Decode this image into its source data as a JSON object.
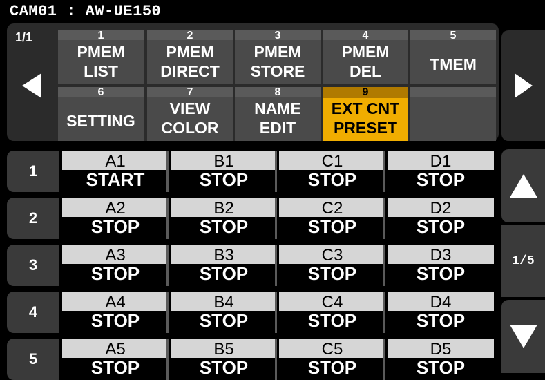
{
  "header": {
    "title": "CAM01 : AW-UE150"
  },
  "menu": {
    "page": "1/1",
    "buttons": [
      {
        "num": "1",
        "lines": [
          "PMEM",
          "LIST"
        ]
      },
      {
        "num": "2",
        "lines": [
          "PMEM",
          "DIRECT"
        ]
      },
      {
        "num": "3",
        "lines": [
          "PMEM",
          "STORE"
        ]
      },
      {
        "num": "4",
        "lines": [
          "PMEM",
          "DEL"
        ]
      },
      {
        "num": "5",
        "lines": [
          "TMEM"
        ]
      },
      {
        "num": "6",
        "lines": [
          "SETTING"
        ]
      },
      {
        "num": "7",
        "lines": [
          "VIEW",
          "COLOR"
        ]
      },
      {
        "num": "8",
        "lines": [
          "NAME",
          "EDIT"
        ]
      },
      {
        "num": "9",
        "lines": [
          "EXT CNT",
          "PRESET"
        ]
      },
      {
        "num": "",
        "lines": []
      }
    ],
    "highlight_color": "#f0ad00"
  },
  "grid": {
    "page": "1/5",
    "rows": [
      {
        "num": "1",
        "cells": [
          {
            "name": "A1",
            "status": "START"
          },
          {
            "name": "B1",
            "status": "STOP"
          },
          {
            "name": "C1",
            "status": "STOP"
          },
          {
            "name": "D1",
            "status": "STOP"
          }
        ]
      },
      {
        "num": "2",
        "cells": [
          {
            "name": "A2",
            "status": "STOP"
          },
          {
            "name": "B2",
            "status": "STOP"
          },
          {
            "name": "C2",
            "status": "STOP"
          },
          {
            "name": "D2",
            "status": "STOP"
          }
        ]
      },
      {
        "num": "3",
        "cells": [
          {
            "name": "A3",
            "status": "STOP"
          },
          {
            "name": "B3",
            "status": "STOP"
          },
          {
            "name": "C3",
            "status": "STOP"
          },
          {
            "name": "D3",
            "status": "STOP"
          }
        ]
      },
      {
        "num": "4",
        "cells": [
          {
            "name": "A4",
            "status": "STOP"
          },
          {
            "name": "B4",
            "status": "STOP"
          },
          {
            "name": "C4",
            "status": "STOP"
          },
          {
            "name": "D4",
            "status": "STOP"
          }
        ]
      },
      {
        "num": "5",
        "cells": [
          {
            "name": "A5",
            "status": "STOP"
          },
          {
            "name": "B5",
            "status": "STOP"
          },
          {
            "name": "C5",
            "status": "STOP"
          },
          {
            "name": "D5",
            "status": "STOP"
          }
        ]
      }
    ]
  },
  "icons": {
    "prev": "left-arrow-icon",
    "next": "right-arrow-icon",
    "up": "up-arrow-icon",
    "down": "down-arrow-icon"
  }
}
